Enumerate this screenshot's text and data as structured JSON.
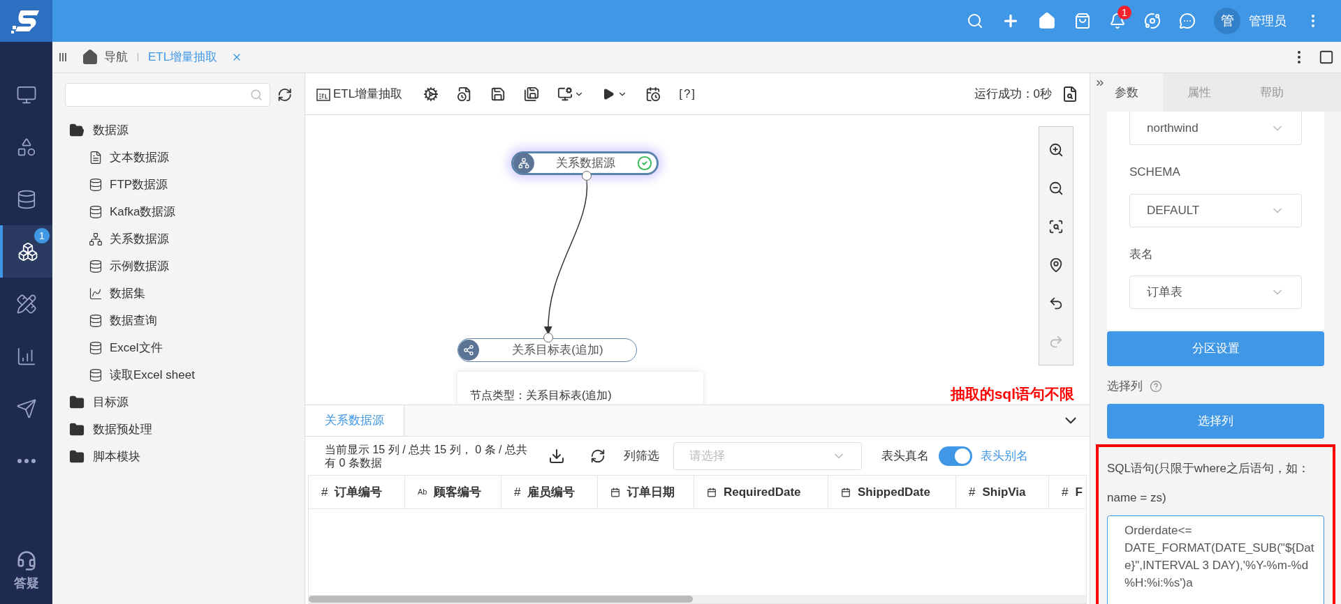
{
  "top_bar": {
    "notification_count": "1",
    "user_initial": "管",
    "user_name": "管理员"
  },
  "nav_rail": {
    "items": [
      {
        "kind": "monitor",
        "selected": false
      },
      {
        "kind": "shapes",
        "selected": false
      },
      {
        "kind": "database",
        "selected": false
      },
      {
        "kind": "cubes",
        "selected": true,
        "badge": "1"
      },
      {
        "kind": "ruler",
        "selected": false
      },
      {
        "kind": "chart",
        "selected": false
      },
      {
        "kind": "send",
        "selected": false
      },
      {
        "kind": "more",
        "selected": false
      }
    ],
    "help_label": "答疑"
  },
  "tabs_bar": {
    "home_label": "导航",
    "tabs": [
      {
        "label": "ETL增量抽取",
        "selected": true
      }
    ]
  },
  "tree": {
    "items": [
      {
        "label": "数据源",
        "expanded": true,
        "children": [
          {
            "label": "文本数据源",
            "kind": "text-file"
          },
          {
            "label": "FTP数据源",
            "kind": "database"
          },
          {
            "label": "Kafka数据源",
            "kind": "database"
          },
          {
            "label": "关系数据源",
            "kind": "relation"
          },
          {
            "label": "示例数据源",
            "kind": "database"
          },
          {
            "label": "数据集",
            "kind": "dataset"
          },
          {
            "label": "数据查询",
            "kind": "database"
          },
          {
            "label": "Excel文件",
            "kind": "database"
          },
          {
            "label": "读取Excel sheet",
            "kind": "database"
          }
        ]
      },
      {
        "label": "目标源",
        "expanded": false
      },
      {
        "label": "数据预处理",
        "expanded": false
      },
      {
        "label": "脚本模块",
        "expanded": false
      }
    ]
  },
  "toolbar": {
    "title": "ETL增量抽取",
    "help": "[?]",
    "status": "运行成功：0秒"
  },
  "canvas": {
    "nodes": [
      {
        "label": "关系数据源",
        "kind": "source",
        "selected": true,
        "ok": true
      },
      {
        "label": "关系目标表(追加)",
        "kind": "target",
        "selected": false,
        "ok": false
      }
    ],
    "tooltip": "节点类型：关系目标表(追加)",
    "annotation": "抽取的sql语句不限"
  },
  "bottom_panel": {
    "tabs": [
      {
        "label": "关系数据源",
        "selected": true
      }
    ],
    "summary": "当前显示 15 列 / 总共 15 列， 0 条 / 总共有 0 条数据",
    "filter_label": "列筛选",
    "filter_placeholder": "请选择",
    "real_name_label": "表头真名",
    "alias_on": true,
    "alias_label": "表头别名",
    "columns": [
      {
        "kind": "mark",
        "mark": "#",
        "label": "订单编号"
      },
      {
        "kind": "mark",
        "mark": "Ab",
        "label": "顾客编号"
      },
      {
        "kind": "mark",
        "mark": "#",
        "label": "雇员编号"
      },
      {
        "kind": "date",
        "label": "订单日期"
      },
      {
        "kind": "date",
        "label": "RequiredDate"
      },
      {
        "kind": "date",
        "label": "ShippedDate"
      },
      {
        "kind": "mark",
        "mark": "#",
        "label": "ShipVia"
      },
      {
        "kind": "mark",
        "mark": "#",
        "label": "F"
      }
    ]
  },
  "right_panel": {
    "tabs": [
      {
        "label": "参数",
        "selected": true
      },
      {
        "label": "属性",
        "selected": false
      },
      {
        "label": "帮助",
        "selected": false
      }
    ],
    "fields": [
      {
        "value": "northwind"
      },
      {
        "label": "SCHEMA",
        "value": "DEFAULT"
      },
      {
        "label": "表名",
        "value": "订单表"
      }
    ],
    "partition_button": "分区设置",
    "columns_label": "选择列",
    "columns_button": "选择列",
    "sql_label": "SQL语句(只限于where之后语句，如：name = zs)",
    "sql_value": "Orderdate<= DATE_FORMAT(DATE_SUB(\"${Date}\",INTERVAL 3 DAY),'%Y-%m-%d %H:%i:%s')a"
  }
}
